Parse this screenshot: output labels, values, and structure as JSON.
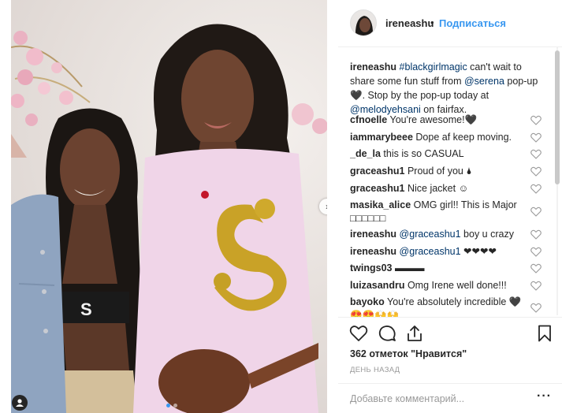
{
  "post": {
    "username": "ireneashu",
    "separator": "•",
    "follow_label": "Подписаться",
    "caption": {
      "username": "ireneashu",
      "hashtag": "#blackgirlmagic",
      "text_1": " can't wait to share some fun stuff from ",
      "mention_1": "@serena",
      "text_2": " pop-up 🖤. Stop by the pop-up today at ",
      "mention_2": "@melodyehsani",
      "text_3": " on fairfax."
    },
    "likes_text": "362 отметок \"Нравится\"",
    "timestamp": "ДЕНЬ НАЗАД",
    "comment_placeholder": "Добавьте комментарий...",
    "more_label": "···",
    "next_arrow": "›"
  },
  "comments": [
    {
      "user": "cfnoelle",
      "text": "You're awesome!🖤"
    },
    {
      "user": "iammarybeee",
      "text": "Dope af keep moving."
    },
    {
      "user": "_de_la",
      "text": "this is so CASUAL"
    },
    {
      "user": "graceashu1",
      "text": "Proud of you 🌢"
    },
    {
      "user": "graceashu1",
      "text": "Nice jacket ☺"
    },
    {
      "user": "masika_alice",
      "text": "OMG girl!! This is Major",
      "text_line2": "□□□□□□"
    },
    {
      "user": "ireneashu",
      "mention": "@graceashu1",
      "text": " boy u crazy"
    },
    {
      "user": "ireneashu",
      "mention": "@graceashu1",
      "text": " ❤❤❤❤"
    },
    {
      "user": "twings03",
      "text": "▬▬▬"
    },
    {
      "user": "luizasandru",
      "text": "Omg Irene well done!!!"
    },
    {
      "user": "bayoko",
      "text": "You're absolutely incredible 🖤",
      "text_line2": "😍😍🙌🙌"
    }
  ],
  "icons": {
    "like": "heart-icon",
    "comment": "comment-icon",
    "share": "share-icon",
    "save": "bookmark-icon",
    "small_like": "heart-outline-icon",
    "tag": "user-tag-icon"
  },
  "colors": {
    "link": "#3897f0",
    "tag": "#003569",
    "text": "#262626",
    "muted": "#999999",
    "shirt": "#f0d5e8",
    "gold": "#c9a227"
  }
}
